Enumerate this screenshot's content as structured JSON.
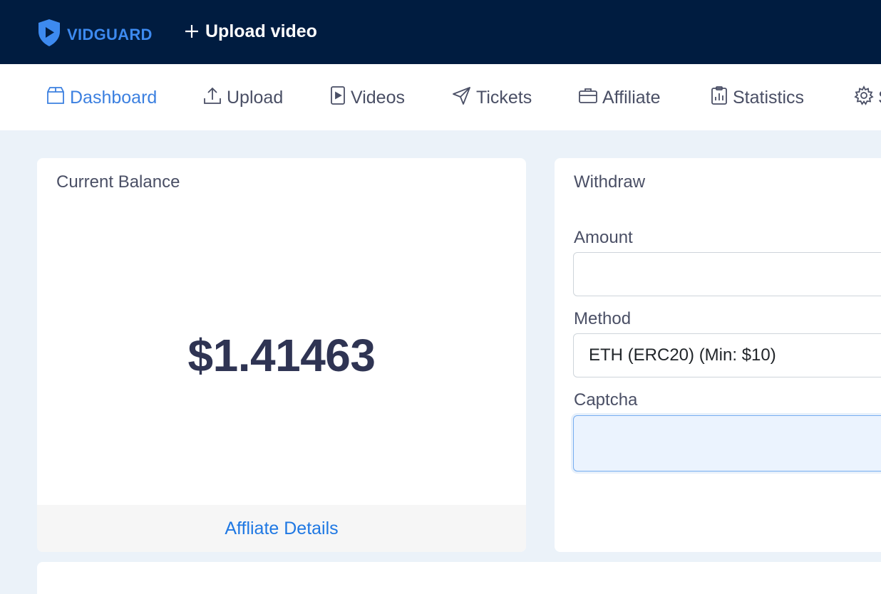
{
  "app": {
    "brand": "VIDGUARD"
  },
  "header": {
    "upload_label": "Upload video"
  },
  "nav": {
    "items": [
      {
        "label": "Dashboard",
        "icon": "box-icon",
        "active": true
      },
      {
        "label": "Upload",
        "icon": "upload-icon"
      },
      {
        "label": "Videos",
        "icon": "video-file-icon"
      },
      {
        "label": "Tickets",
        "icon": "send-icon"
      },
      {
        "label": "Affiliate",
        "icon": "briefcase-icon"
      },
      {
        "label": "Statistics",
        "icon": "clipboard-chart-icon"
      },
      {
        "label": "S",
        "icon": "gear-icon"
      }
    ]
  },
  "balance_card": {
    "title": "Current Balance",
    "value": "$1.41463",
    "footer_link": "Affliate Details"
  },
  "withdraw_card": {
    "title": "Withdraw",
    "amount_label": "Amount",
    "amount_value": "",
    "method_label": "Method",
    "method_value": "ETH (ERC20) (Min: $10)",
    "captcha_label": "Captcha",
    "captcha_value": ""
  },
  "colors": {
    "topbar": "#001c40",
    "accent": "#3c80e0",
    "link": "#1f78e3",
    "page_bg": "#ebf2f9"
  }
}
